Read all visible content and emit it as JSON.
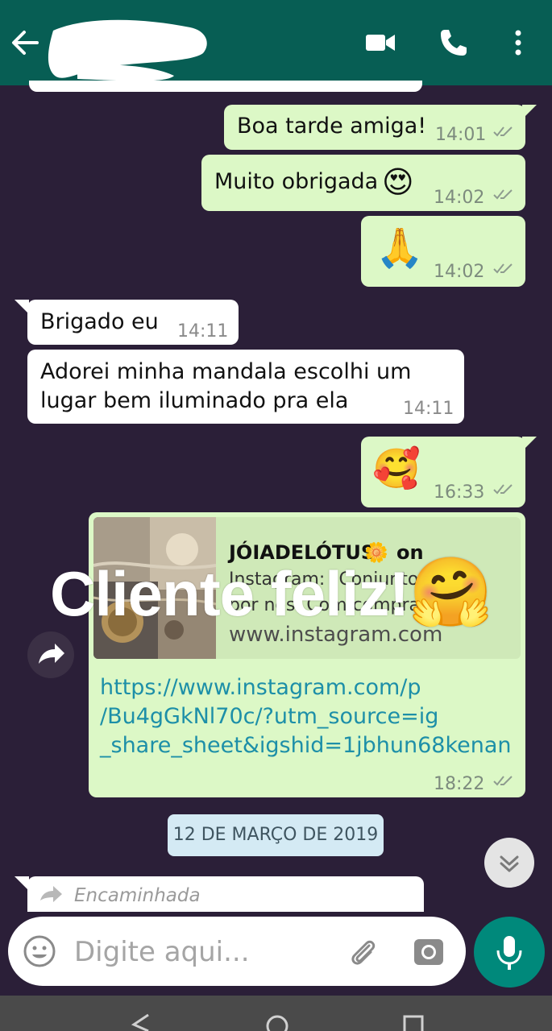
{
  "header": {
    "redacted_name": "",
    "icons": [
      "back-icon",
      "video-call-icon",
      "phone-call-icon",
      "more-vert-icon"
    ]
  },
  "messages": [
    {
      "id": "m1",
      "direction": "out",
      "text": "Boa tarde amiga!",
      "time": "14:01"
    },
    {
      "id": "m2",
      "direction": "out",
      "text": "Muito obrigada",
      "emoji": "😍",
      "time": "14:02"
    },
    {
      "id": "m3",
      "direction": "out",
      "emoji": "🙏",
      "time": "14:02"
    },
    {
      "id": "m4",
      "direction": "in",
      "text": "Brigado eu",
      "time": "14:11"
    },
    {
      "id": "m5",
      "direction": "in",
      "lines": [
        "Adorei minha mandala escolhi um",
        "lugar bem iluminado pra ela"
      ],
      "time": "14:11"
    },
    {
      "id": "m6",
      "direction": "out",
      "emoji": "🥰",
      "time": "16:33"
    },
    {
      "id": "m7",
      "direction": "out",
      "time": "18:22",
      "preview": {
        "title_line": "JÓIADELÓTUS",
        "title_flower": "🌼",
        "title_suffix": "on",
        "desc_line1": "Instagram: \"Conjunto",
        "desc_line2": "por nós. Com compra",
        "domain": "www.instagram.com"
      },
      "link_lines": [
        "https://www.instagram.com/p",
        "/Bu4gGkNl70c/?utm_source=ig",
        "_share_sheet&igshid=1jbhun68kenan"
      ]
    }
  ],
  "overlay": {
    "text": "Cliente feliz!",
    "emoji": "🤗"
  },
  "date_chip": "12 DE MARÇO DE 2019",
  "forwarded_label": "Encaminhada",
  "composer": {
    "placeholder": "Digite aqui..."
  },
  "colors": {
    "header": "#075e54",
    "background": "#2b1f38",
    "outgoing_bubble": "#dcf8c6",
    "incoming_bubble": "#ffffff",
    "link": "#1d8fa8",
    "mic_button": "#00897b"
  }
}
